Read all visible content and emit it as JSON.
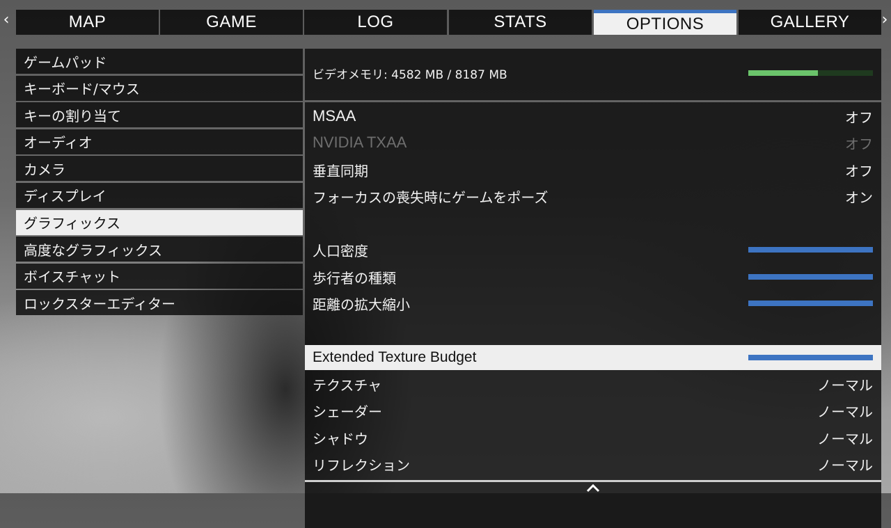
{
  "nav": {
    "left_arrow": "‹",
    "right_arrow": "›",
    "tabs": [
      {
        "label": "MAP"
      },
      {
        "label": "GAME"
      },
      {
        "label": "LOG"
      },
      {
        "label": "STATS"
      },
      {
        "label": "OPTIONS"
      },
      {
        "label": "GALLERY"
      }
    ],
    "active_tab": "OPTIONS"
  },
  "sidebar": {
    "items": [
      {
        "label": "ゲームパッド"
      },
      {
        "label": "キーボード/マウス"
      },
      {
        "label": "キーの割り当て"
      },
      {
        "label": "オーディオ"
      },
      {
        "label": "カメラ"
      },
      {
        "label": "ディスプレイ"
      },
      {
        "label": "グラフィックス"
      },
      {
        "label": "高度なグラフィックス"
      },
      {
        "label": "ボイスチャット"
      },
      {
        "label": "ロックスターエディター"
      }
    ],
    "active_item": "グラフィックス"
  },
  "video_memory": {
    "label": "ビデオメモリ: 4582 MB / 8187 MB",
    "used_fraction": 0.56,
    "bar_color": "#6bc46b"
  },
  "settings": {
    "msaa": {
      "label": "MSAA",
      "value": "オフ"
    },
    "txaa": {
      "label": "NVIDIA TXAA",
      "value": "オフ",
      "disabled": true
    },
    "vsync": {
      "label": "垂直同期",
      "value": "オフ"
    },
    "pause_focus": {
      "label": "フォーカスの喪失時にゲームをポーズ",
      "value": "オン"
    },
    "population_density": {
      "label": "人口密度",
      "level": 1.0
    },
    "population_variety": {
      "label": "歩行者の種類",
      "level": 1.0
    },
    "distance_scaling": {
      "label": "距離の拡大縮小",
      "level": 1.0
    },
    "texture_budget": {
      "label": "Extended Texture Budget",
      "level": 1.0,
      "highlighted": true
    },
    "texture_quality": {
      "label": "テクスチャ",
      "value": "ノーマル"
    },
    "shader_quality": {
      "label": "シェーダー",
      "value": "ノーマル"
    },
    "shadow_quality": {
      "label": "シャドウ",
      "value": "ノーマル"
    },
    "reflection_quality": {
      "label": "リフレクション",
      "value": "ノーマル"
    }
  },
  "colors": {
    "accent": "#3d74c2",
    "panel": "#0a0a0a",
    "highlight": "#eeeeee"
  },
  "icons": {
    "scroll": "scroll-up-icon"
  }
}
